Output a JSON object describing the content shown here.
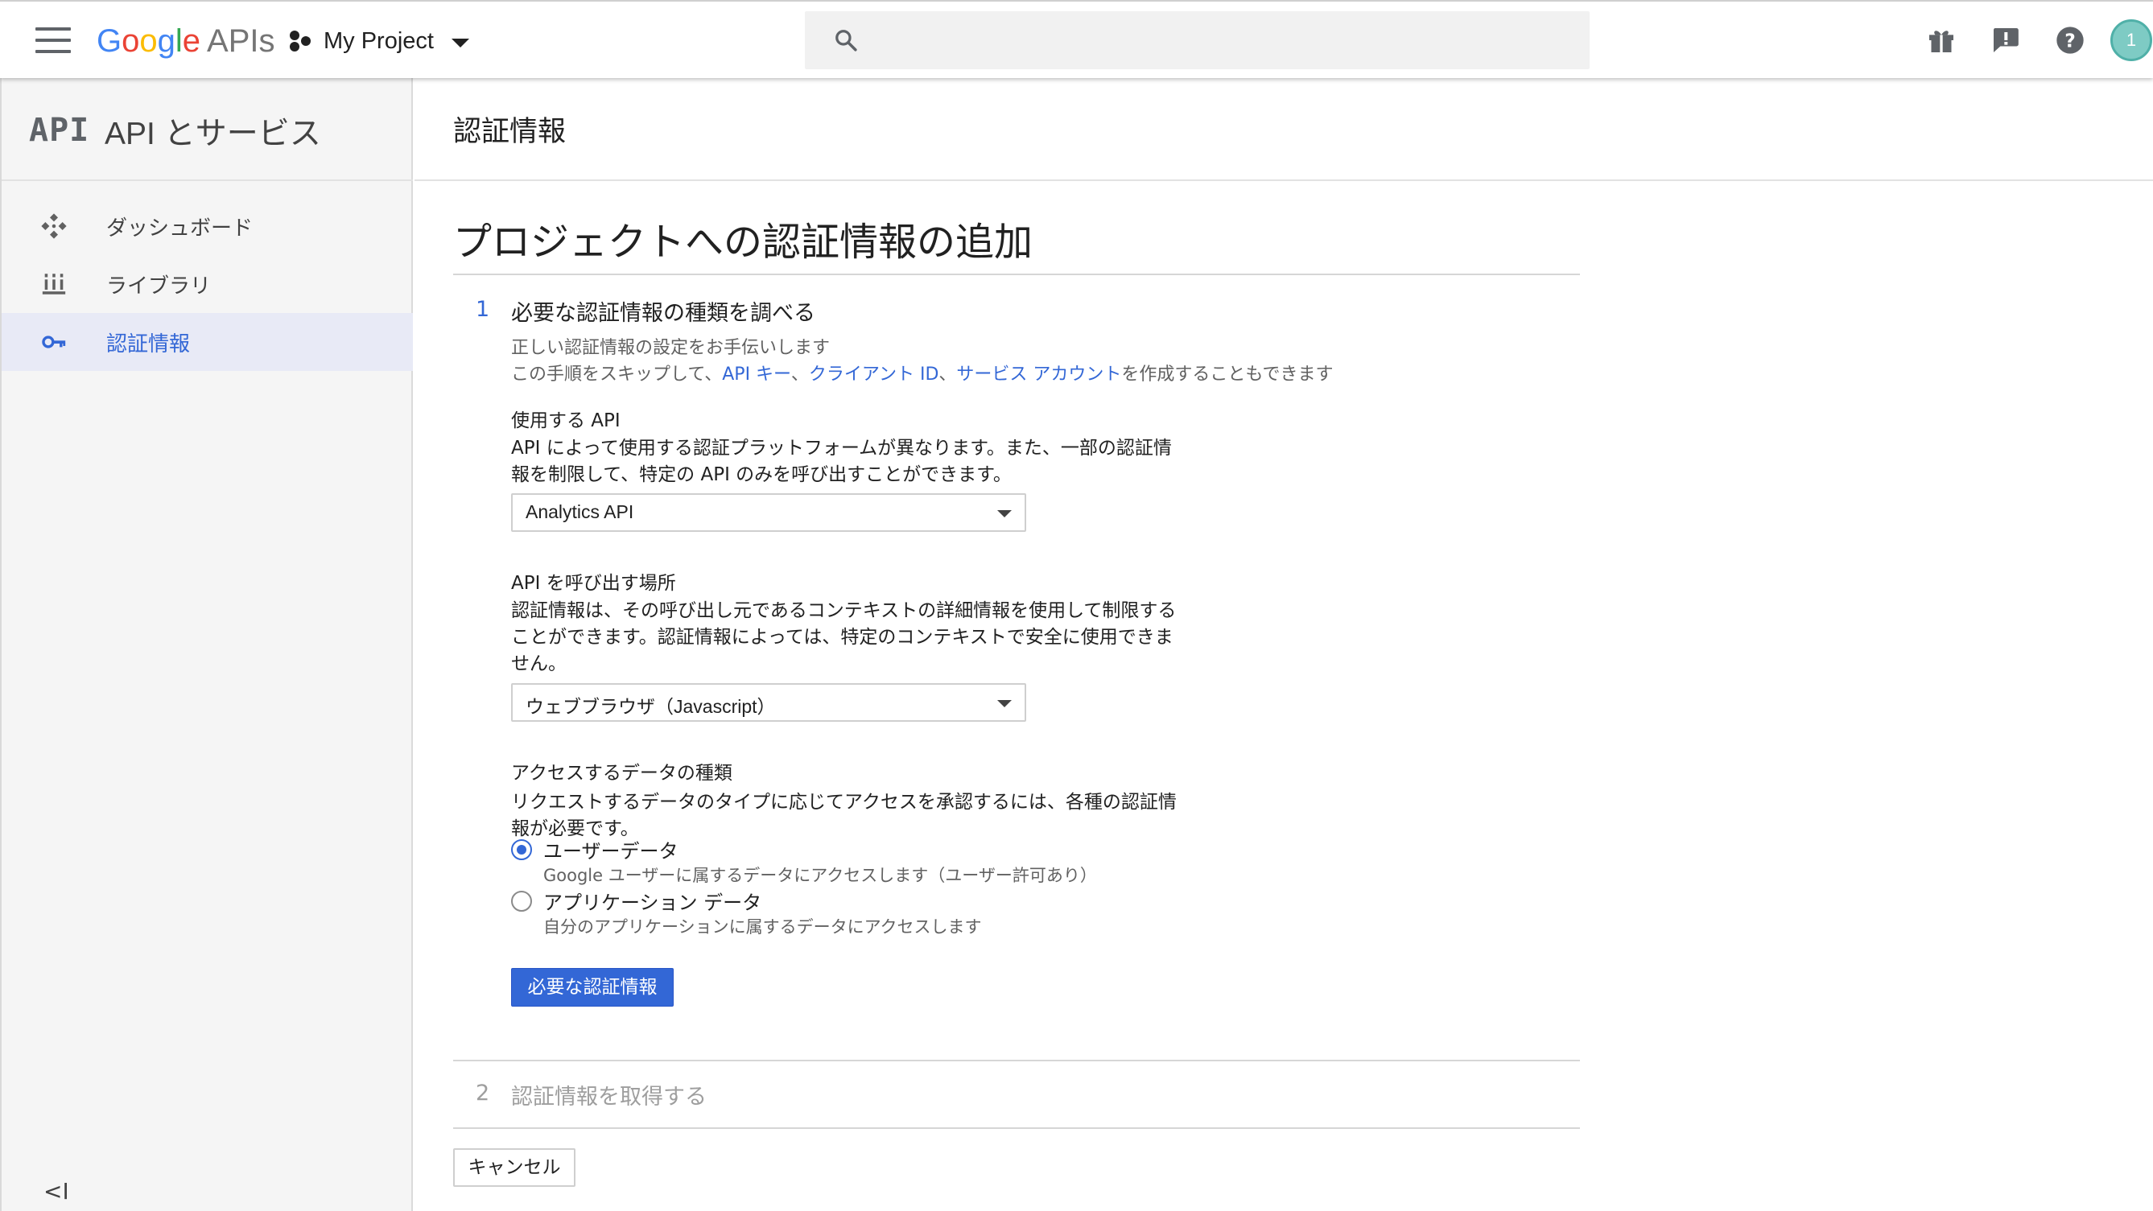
{
  "topbar": {
    "logo_google": "Google",
    "logo_apis": "APIs",
    "project_name": "My Project",
    "search_placeholder": "",
    "avatar_initial": "1"
  },
  "sidebar": {
    "api_mark": "API",
    "title": "API とサービス",
    "items": [
      {
        "label": "ダッシュボード",
        "icon": "dashboard-icon",
        "active": false
      },
      {
        "label": "ライブラリ",
        "icon": "library-icon",
        "active": false
      },
      {
        "label": "認証情報",
        "icon": "key-icon",
        "active": true
      }
    ],
    "collapse_glyph": "<I"
  },
  "page": {
    "header_title": "認証情報",
    "heading": "プロジェクトへの認証情報の追加"
  },
  "step1": {
    "number": "1",
    "title": "必要な認証情報の種類を調べる",
    "help_line1": "正しい認証情報の設定をお手伝いします",
    "help_line2_prefix": "この手順をスキップして、",
    "link_api_key": "API キー",
    "sep1": "、",
    "link_client_id": "クライアント ID",
    "sep2": "、",
    "link_service_account": "サービス アカウント",
    "help_line2_suffix": "を作成することもできます",
    "api_section": {
      "title": "使用する API",
      "desc_line1": "API によって使用する認証プラットフォームが異なります。また、一部の認証情",
      "desc_line2": "報を制限して、特定の API のみを呼び出すことができます。",
      "selected": "Analytics API"
    },
    "place_section": {
      "title": "API を呼び出す場所",
      "desc_line1": "認証情報は、その呼び出し元であるコンテキストの詳細情報を使用して制限する",
      "desc_line2": "ことができます。認証情報によっては、特定のコンテキストで安全に使用できま",
      "desc_line3": "せん。",
      "selected": "ウェブブラウザ（Javascript）"
    },
    "data_section": {
      "title": "アクセスするデータの種類",
      "desc_line1": "リクエストするデータのタイプに応じてアクセスを承認するには、各種の認証情",
      "desc_line2": "報が必要です。",
      "options": [
        {
          "label": "ユーザーデータ",
          "sub": "Google ユーザーに属するデータにアクセスします（ユーザー許可あり）",
          "checked": true
        },
        {
          "label": "アプリケーション データ",
          "sub": "自分のアプリケーションに属するデータにアクセスします",
          "checked": false
        }
      ]
    },
    "button": "必要な認証情報"
  },
  "step2": {
    "number": "2",
    "title": "認証情報を取得する"
  },
  "cancel": "キャンセル",
  "colors": {
    "accent": "#3367d6",
    "sidebar_bg": "#f5f5f5",
    "sidebar_active_bg": "#e8eaf6",
    "muted": "#9e9e9e"
  }
}
